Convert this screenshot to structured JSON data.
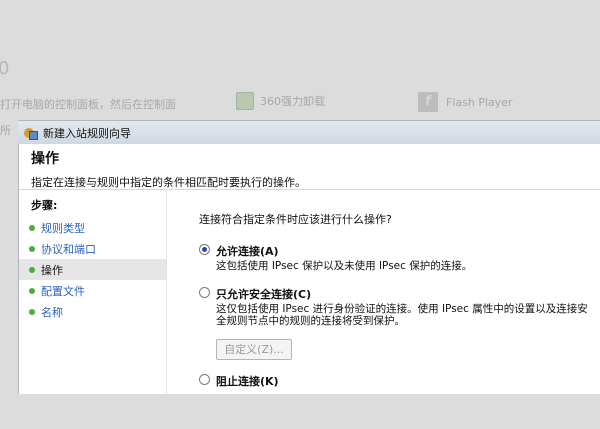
{
  "background": {
    "text_line1": "打开电脑的控制面板，然后在控制面",
    "text_line2": "所",
    "app1": "360强力卸载",
    "app2": "Flash Player"
  },
  "window": {
    "title": "新建入站规则向导",
    "header_title": "操作",
    "header_subtitle": "指定在连接与规则中指定的条件相匹配时要执行的操作。"
  },
  "steps": {
    "heading": "步骤:",
    "items": [
      {
        "label": "规则类型"
      },
      {
        "label": "协议和端口"
      },
      {
        "label": "操作"
      },
      {
        "label": "配置文件"
      },
      {
        "label": "名称"
      }
    ]
  },
  "main": {
    "question": "连接符合指定条件时应该进行什么操作?",
    "options": [
      {
        "label": "允许连接(A)",
        "desc": "这包括使用 IPsec 保护以及未使用 IPsec 保护的连接。",
        "selected": true
      },
      {
        "label": "只允许安全连接(C)",
        "desc_line1": "这仅包括使用 IPsec 进行身份验证的连接。使用 IPsec 属性中的设置以及连接安",
        "desc_line2": "全规则节点中的规则的连接将受到保护。",
        "selected": false
      },
      {
        "label": "阻止连接(K)",
        "selected": false
      }
    ],
    "customize_button": "自定义(Z)..."
  }
}
